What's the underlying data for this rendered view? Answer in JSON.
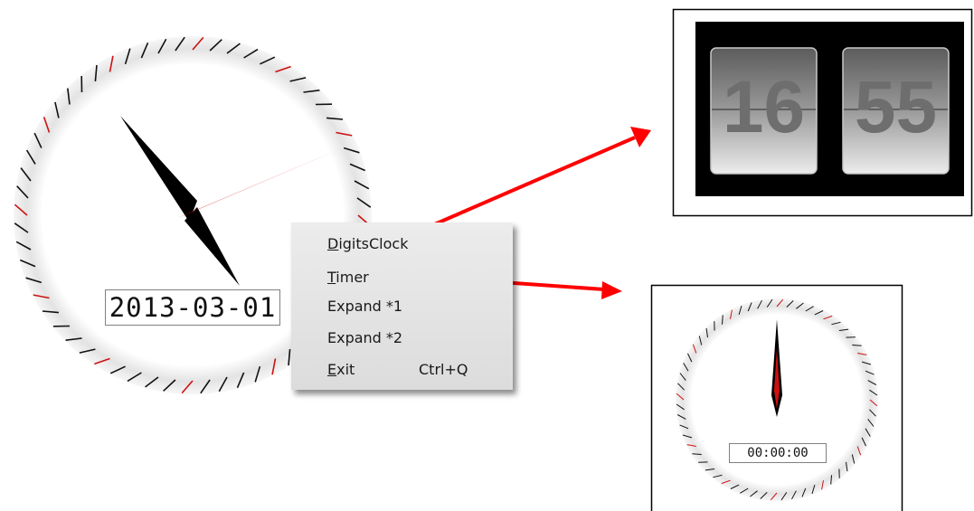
{
  "analog_clock": {
    "date": "2013-03-01",
    "time": "16:55",
    "colors": {
      "hour_hand": "#000000",
      "second_hand": "#cc1111",
      "tick_major": "#cc1111",
      "tick_minor": "#111111"
    }
  },
  "context_menu": {
    "items": [
      {
        "label": "DigitsClock",
        "accel": "D",
        "shortcut": ""
      },
      {
        "label": "Timer",
        "accel": "T",
        "shortcut": ""
      },
      {
        "label": "Expand *1",
        "accel": "",
        "shortcut": ""
      },
      {
        "label": "Expand *2",
        "accel": "",
        "shortcut": ""
      },
      {
        "label": "Exit",
        "accel": "E",
        "shortcut": "Ctrl+Q"
      }
    ]
  },
  "digits_clock_preview": {
    "hours": "16",
    "minutes": "55",
    "background": "#000000"
  },
  "timer_preview": {
    "display": "00:00:00"
  },
  "arrows": {
    "color": "#ff0000"
  }
}
